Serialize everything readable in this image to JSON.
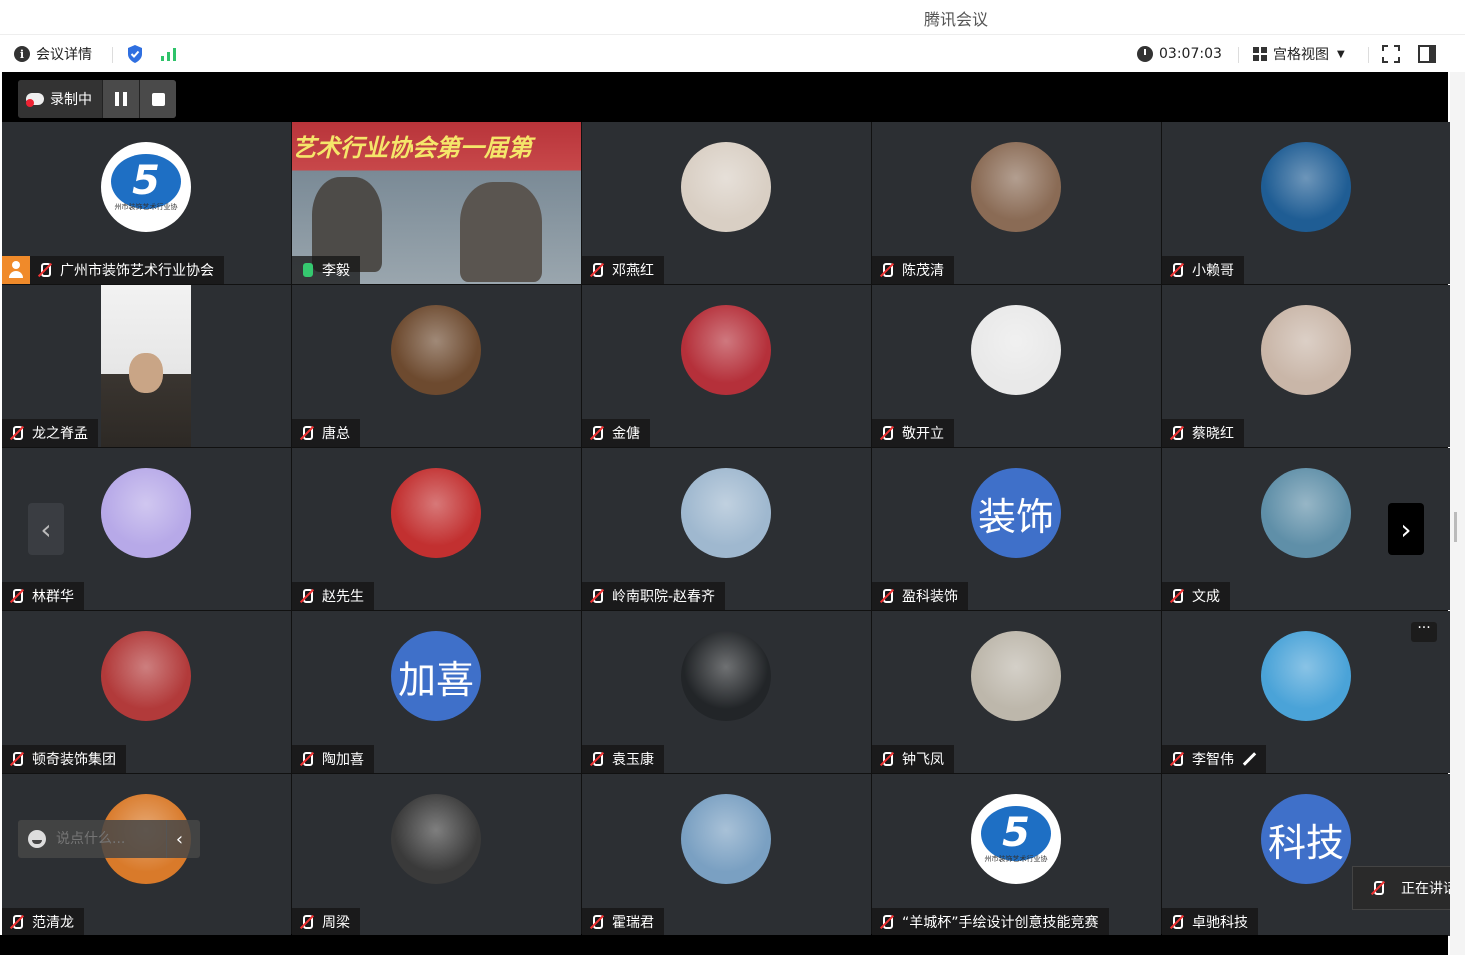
{
  "window": {
    "title": "腾讯会议"
  },
  "toolbar": {
    "meeting_info_label": "会议详情",
    "timer": "03:07:03",
    "view_label": "宫格视图"
  },
  "recording": {
    "label": "录制中"
  },
  "participants": [
    {
      "name": "广州市装饰艺术行业协会",
      "avatar": "logo",
      "host": true
    },
    {
      "name": "李毅",
      "avatar": "video",
      "mic_on": true,
      "active": true
    },
    {
      "name": "邓燕红",
      "avatar": "photo",
      "color": "#d9cfc4"
    },
    {
      "name": "陈茂清",
      "avatar": "photo",
      "color": "#8a6b55"
    },
    {
      "name": "小赖哥",
      "avatar": "photo",
      "color": "#1f5d94"
    },
    {
      "name": "龙之脊孟",
      "avatar": "video-portrait"
    },
    {
      "name": "唐总",
      "avatar": "photo",
      "color": "#6d4a2f"
    },
    {
      "name": "金傏",
      "avatar": "photo",
      "color": "#b5303a"
    },
    {
      "name": "敬开立",
      "avatar": "photo",
      "color": "#e9e9e9"
    },
    {
      "name": "蔡晓红",
      "avatar": "photo",
      "color": "#c9b6a8"
    },
    {
      "name": "林群华",
      "avatar": "photo",
      "color": "#b7a9e8"
    },
    {
      "name": "赵先生",
      "avatar": "photo",
      "color": "#c23030"
    },
    {
      "name": "岭南职院-赵春齐",
      "avatar": "photo",
      "color": "#9fb8cf"
    },
    {
      "name": "盈科装饰",
      "avatar": "text",
      "text": "装饰"
    },
    {
      "name": "文成",
      "avatar": "photo",
      "color": "#5f8fa8"
    },
    {
      "name": "顿奇装饰集团",
      "avatar": "photo",
      "color": "#b23a3a"
    },
    {
      "name": "陶加喜",
      "avatar": "text",
      "text": "加喜"
    },
    {
      "name": "袁玉康",
      "avatar": "photo",
      "color": "#222528"
    },
    {
      "name": "钟飞凤",
      "avatar": "photo",
      "color": "#bdb7ab"
    },
    {
      "name": "李智伟",
      "avatar": "photo",
      "color": "#4aa3d8",
      "pen": true
    },
    {
      "name": "范清龙",
      "avatar": "photo",
      "color": "#d97a2a"
    },
    {
      "name": "周梁",
      "avatar": "photo",
      "color": "#3a3a3a"
    },
    {
      "name": "霍瑞君",
      "avatar": "photo",
      "color": "#7aa0c2"
    },
    {
      "name": "“羊城杯”手绘设计创意技能竞赛",
      "avatar": "logo"
    },
    {
      "name": "卓驰科技",
      "avatar": "text",
      "text": "科技"
    }
  ],
  "video_tile": {
    "banner": "艺术行业协会第一届第"
  },
  "logo_text": "5",
  "logo_caption": "州市装饰艺术行业协",
  "chat": {
    "placeholder": "说点什么..."
  },
  "speaking": {
    "label": "正在讲话"
  },
  "colors": {
    "accent_green": "#2fc36a",
    "avatar_blue": "#3f70c9",
    "tile_bg": "#2c2f33"
  }
}
